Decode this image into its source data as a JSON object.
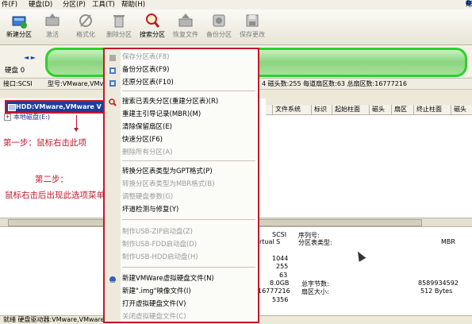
{
  "menubar": {
    "items": [
      "件(F)",
      "硬盘(D)",
      "分区(P)",
      "工具(T)",
      "帮助(H)"
    ],
    "help_label": "帮助"
  },
  "toolbar": {
    "buttons": [
      {
        "label": "新建分区",
        "icon": "new-partition-icon",
        "enabled": true
      },
      {
        "label": "激活",
        "icon": "activate-icon",
        "enabled": false
      },
      {
        "label": "格式化",
        "icon": "format-icon",
        "enabled": false
      },
      {
        "label": "删除分区",
        "icon": "delete-icon",
        "enabled": false
      },
      {
        "label": "搜索分区",
        "icon": "search-icon",
        "enabled": true
      },
      {
        "label": "恢复文件",
        "icon": "recover-icon",
        "enabled": false
      },
      {
        "label": "备份分区",
        "icon": "backup-icon",
        "enabled": false
      },
      {
        "label": "保存更改",
        "icon": "save-icon",
        "enabled": false
      }
    ]
  },
  "disk_panel": {
    "label": "硬盘 0",
    "nav": "◄ ►"
  },
  "infoline": {
    "iface": "接口:SCSI",
    "model": "型号:VMware,VMv",
    "tail": "4  磁头数:255  每道扇区数:63  总扇区数:16777216"
  },
  "tree": {
    "selected": "HDD:VMware,VMware V",
    "sub": "本地磁盘(E:)"
  },
  "annotations": {
    "step1": "第一步：鼠标右击此项",
    "step2_title": "第二步：",
    "step2_body": "鼠标右击后出现此选项菜单栏"
  },
  "table": {
    "headers": [
      "文件系统",
      "标识",
      "起始柱面",
      "磁头",
      "扇区",
      "终止柱面",
      "磁头"
    ]
  },
  "details": {
    "col1": [
      "SCSI",
      "rtual S",
      "1044",
      "255",
      "63",
      "8.0GB",
      "16777216",
      "5356"
    ],
    "serial_label": "序列号:",
    "pt_label": "分区表类型:",
    "pt_value": "MBR",
    "total_bytes_label": "总字节数:",
    "total_bytes_value": "8589934592",
    "sector_label": "扇区大小:",
    "sector_value": "512 Bytes"
  },
  "status": "就绪   硬盘驱动器:VMware,VMware Virtual S",
  "context_menu": {
    "groups": [
      [
        {
          "label": "保存分区表(F8)",
          "enabled": false,
          "icon": "save-table-icon"
        },
        {
          "label": "备份分区表(F9)",
          "enabled": true,
          "icon": "backup-table-icon"
        },
        {
          "label": "还原分区表(F10)",
          "enabled": true,
          "icon": "restore-table-icon"
        }
      ],
      [
        {
          "label": "搜索已丢失分区(重建分区表)(R)",
          "enabled": true,
          "icon": "search-lost-icon"
        },
        {
          "label": "重建主引导记录(MBR)(M)",
          "enabled": true,
          "icon": ""
        },
        {
          "label": "清除保留扇区(E)",
          "enabled": true,
          "icon": ""
        },
        {
          "label": "快速分区(F6)",
          "enabled": true,
          "icon": ""
        },
        {
          "label": "删除所有分区(A)",
          "enabled": false,
          "icon": ""
        }
      ],
      [
        {
          "label": "转换分区表类型为GPT格式(P)",
          "enabled": true,
          "icon": ""
        },
        {
          "label": "转换分区表类型为MBR格式(B)",
          "enabled": false,
          "icon": ""
        },
        {
          "label": "调整硬盘参数(G)",
          "enabled": false,
          "icon": ""
        },
        {
          "label": "坏道检测与修复(Y)",
          "enabled": true,
          "icon": ""
        }
      ],
      [
        {
          "label": "制作USB-ZIP启动盘(Z)",
          "enabled": false,
          "icon": ""
        },
        {
          "label": "制作USB-FDD启动盘(D)",
          "enabled": false,
          "icon": ""
        },
        {
          "label": "制作USB-HDD启动盘(H)",
          "enabled": false,
          "icon": ""
        }
      ],
      [
        {
          "label": "新建VMWare虚拟硬盘文件(N)",
          "enabled": true,
          "icon": "new-vmdk-icon"
        },
        {
          "label": "新建\".img\"映像文件(I)",
          "enabled": true,
          "icon": ""
        },
        {
          "label": "打开虚拟硬盘文件(V)",
          "enabled": true,
          "icon": ""
        },
        {
          "label": "关闭虚拟硬盘文件(C)",
          "enabled": false,
          "icon": ""
        }
      ]
    ]
  }
}
